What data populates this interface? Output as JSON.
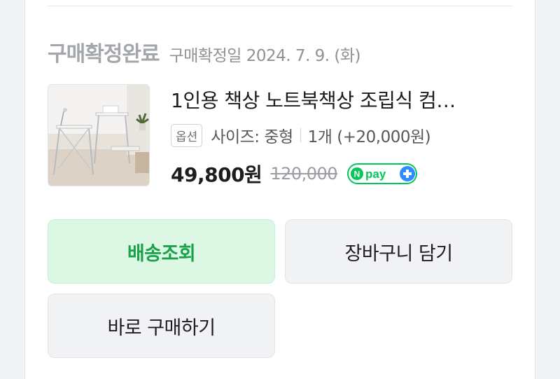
{
  "order": {
    "status": "구매확정완료",
    "confirmed_date": "구매확정일 2024. 7. 9. (화)"
  },
  "product": {
    "name": "1인용 책상 노트북책상 조립식 컴…",
    "image_alt": "folding desk photo",
    "option_badge": "옵션",
    "option_size": "사이즈: 중형",
    "option_qty": "1개 (+20,000원)",
    "price": "49,800원",
    "original_price": "120,000",
    "pay_badge": "Npay+"
  },
  "actions": {
    "track_label": "배송조회",
    "cart_label": "장바구니 담기",
    "buy_label": "바로 구매하기"
  },
  "colors": {
    "accent_green": "#1aa24a",
    "track_bg": "#dcf7e3",
    "npay_green": "#03c75a",
    "npay_plus_blue": "#2d8cff"
  }
}
